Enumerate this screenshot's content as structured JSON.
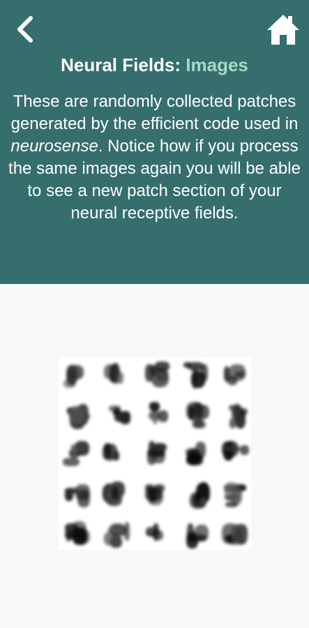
{
  "header": {
    "back_icon": "chevron-left-icon",
    "home_icon": "home-icon",
    "title_prefix": "Neural Fields: ",
    "title_accent": "Images",
    "description_part1": "These are randomly collected patches generated by the efficient code used in ",
    "description_italic": "neurosense",
    "description_part2": ". Notice how if you process the same images again you will be able to see a new patch section of your neural receptive fields."
  },
  "colors": {
    "header_bg": "#356e6c",
    "title_accent": "#a8d8c4",
    "page_bg": "#f8f8f8"
  },
  "patch_grid": {
    "rows": 5,
    "cols": 5,
    "patch_count": 25
  }
}
